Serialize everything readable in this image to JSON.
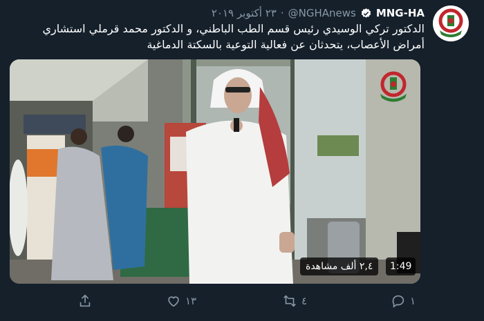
{
  "tweet": {
    "display_name": "MNG-HA",
    "handle": "@NGHAnews",
    "separator": "·",
    "date": "٢٣ أكتوبر ٢٠١٩",
    "text": "الدكتور تركي الوسيدي رئيس قسم الطب الباطني، و الدكتور محمد قرملي استشاري أمراض الأعصاب، يتحدثان عن فعالية التوعية بالسكتة الدماغية"
  },
  "video": {
    "views": "٢,٤ ألف مشاهدة",
    "duration": "1:49"
  },
  "actions": {
    "reply_count": "١",
    "retweet_count": "٤",
    "like_count": "١٣"
  },
  "colors": {
    "background": "#15202b",
    "secondary_text": "#8899a6",
    "brand_red": "#c1272d",
    "verified": "#ffffff"
  },
  "icons": [
    "avatar-logo",
    "verified-icon",
    "reply-icon",
    "retweet-icon",
    "like-icon",
    "share-icon"
  ]
}
